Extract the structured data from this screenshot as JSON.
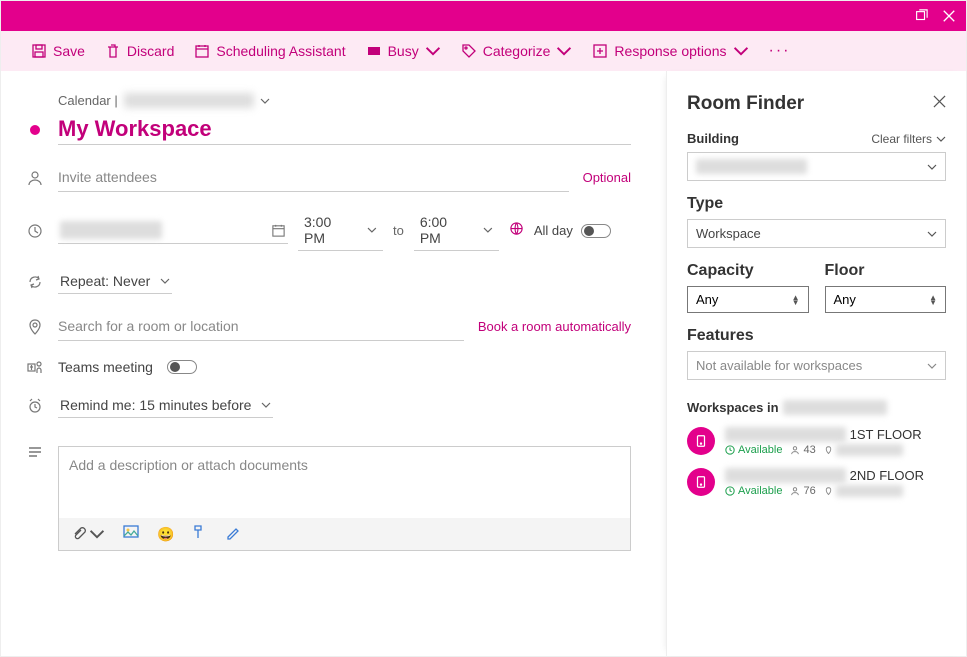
{
  "toolbar": {
    "save": "Save",
    "discard": "Discard",
    "scheduling": "Scheduling Assistant",
    "busy": "Busy",
    "categorize": "Categorize",
    "response": "Response options"
  },
  "breadcrumb": {
    "label": "Calendar |",
    "account": "redacted"
  },
  "event": {
    "title": "My Workspace",
    "attendees_placeholder": "Invite attendees",
    "optional": "Optional",
    "date": "redacted",
    "start": "3:00 PM",
    "to": "to",
    "end": "6:00 PM",
    "allday": "All day",
    "repeat": "Repeat: Never",
    "location_placeholder": "Search for a room or location",
    "book_link": "Book a room automatically",
    "teams": "Teams meeting",
    "remind": "Remind me: 15 minutes before",
    "desc_placeholder": "Add a description or attach documents"
  },
  "room_finder": {
    "title": "Room Finder",
    "building_label": "Building",
    "clear": "Clear filters",
    "building_value": "redacted",
    "type_label": "Type",
    "type_value": "Workspace",
    "capacity_label": "Capacity",
    "capacity_value": "Any",
    "floor_label": "Floor",
    "floor_value": "Any",
    "features_label": "Features",
    "features_value": "Not available for workspaces",
    "ws_header_prefix": "Workspaces in",
    "ws_header_building": "redacted",
    "workspaces": [
      {
        "name_prefix": "redacted",
        "name_suffix": "1ST FLOOR",
        "status": "Available",
        "capacity": "43",
        "location": "redacted"
      },
      {
        "name_prefix": "redacted",
        "name_suffix": "2ND FLOOR",
        "status": "Available",
        "capacity": "76",
        "location": "redacted"
      }
    ]
  }
}
